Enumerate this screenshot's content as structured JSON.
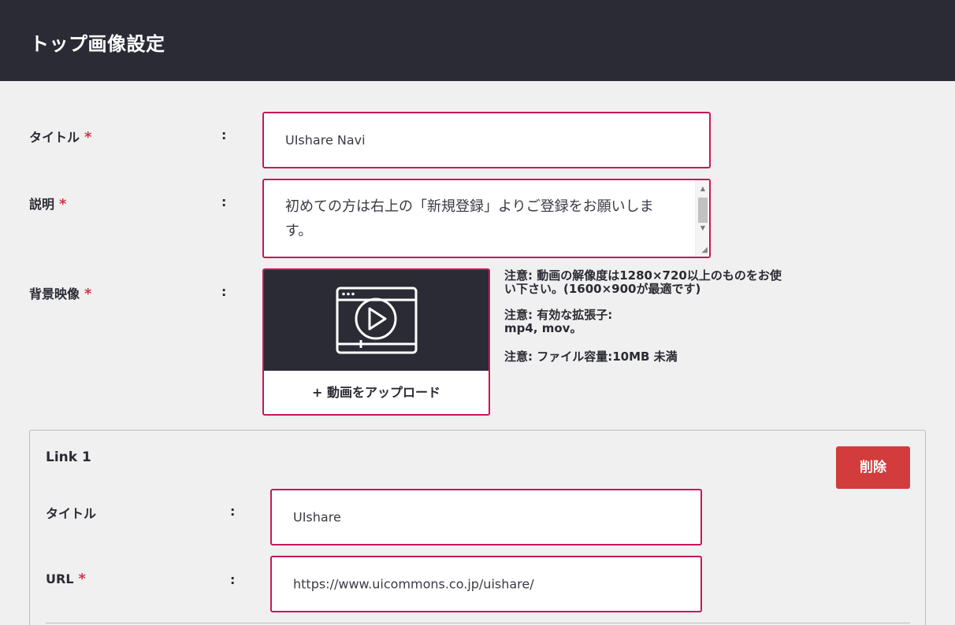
{
  "header": {
    "title": "トップ画像設定"
  },
  "form": {
    "title": {
      "label": "タイトル",
      "required": "*",
      "colon": ":",
      "value": "UIshare Navi"
    },
    "description": {
      "label": "説明",
      "required": "*",
      "colon": ":",
      "value": "初めての方は右上の「新規登録」よりご登録をお願いします。"
    },
    "background_video": {
      "label": "背景映像",
      "required": "*",
      "colon": ":",
      "upload_label": "+ 動画をアップロード",
      "note_resolution": "注意: 動画の解像度は1280×720以上のものをお使い下さい。(1600×900が最適です)",
      "note_extensions": "注意: 有効な拡張子: mp4, mov。",
      "note_size": "注意: ファイル容量:10MB 未満"
    }
  },
  "link1": {
    "heading": "Link 1",
    "delete_label": "削除",
    "title": {
      "label": "タイトル",
      "colon": ":",
      "value": "UIshare"
    },
    "url": {
      "label": "URL",
      "required": "*",
      "colon": ":",
      "value": "https://www.uicommons.co.jp/uishare/"
    }
  },
  "colors": {
    "header_bg": "#2b2b36",
    "accent": "#c8175a",
    "danger": "#d23c3c",
    "required": "#d0364a"
  },
  "icons": {
    "video": "video-player-icon"
  }
}
